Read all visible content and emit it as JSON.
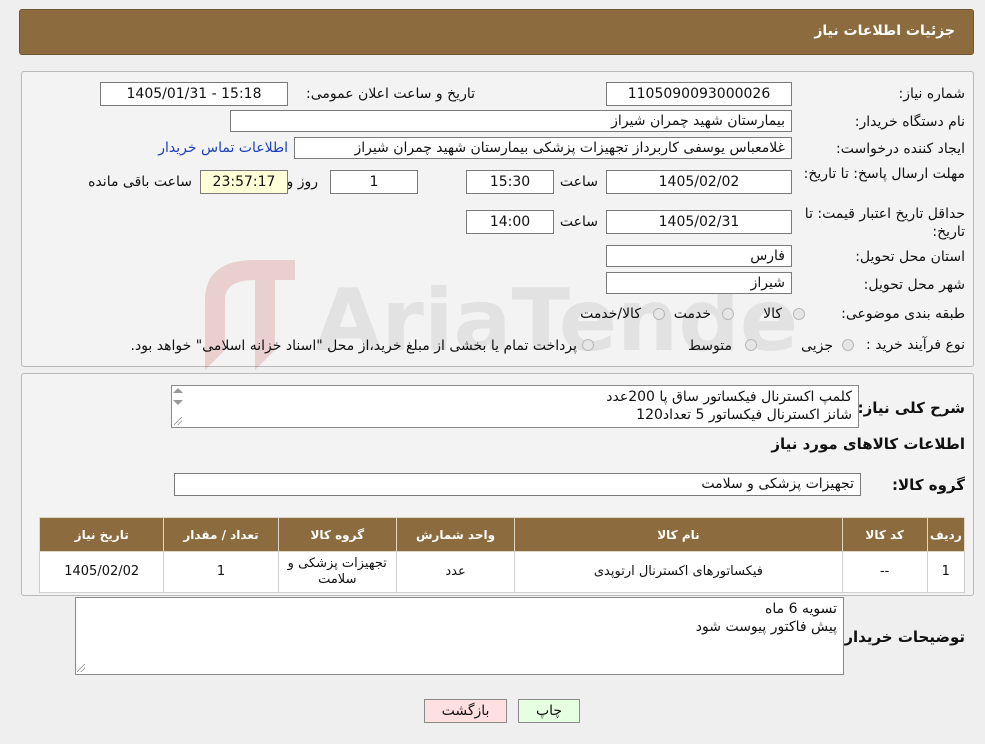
{
  "header": {
    "title": "جزئیات اطلاعات نیاز"
  },
  "info": {
    "need_number_label": "شماره نیاز:",
    "need_number": "1105090093000026",
    "announce_label": "تاریخ و ساعت اعلان عمومی:",
    "announce_value": "1405/01/31 - 15:18",
    "buyer_org_label": "نام دستگاه خریدار:",
    "buyer_org": "بیمارستان شهید چمران شیراز",
    "creator_label": "ایجاد کننده درخواست:",
    "creator": "غلامعباس  یوسفی کاربرداز تجهیزات پزشکی بیمارستان شهید چمران شیراز",
    "contact_link": "اطلاعات تماس خریدار",
    "deadline_label": "مهلت ارسال پاسخ: تا تاریخ:",
    "deadline_date": "1405/02/02",
    "time_label": "ساعت",
    "deadline_time": "15:30",
    "days": "1",
    "days_label": "روز و",
    "remaining": "23:57:17",
    "remaining_label": "ساعت باقی مانده",
    "validity_label": "حداقل تاریخ اعتبار قیمت: تا تاریخ:",
    "validity_date": "1405/02/31",
    "validity_time": "14:00",
    "province_label": "استان محل تحویل:",
    "province": "فارس",
    "city_label": "شهر محل تحویل:",
    "city": "شیراز",
    "category_label": "طبقه بندی موضوعی:",
    "category_options": [
      "کالا",
      "خدمت",
      "کالا/خدمت"
    ],
    "process_label": "نوع فرآیند خرید :",
    "process_options": [
      "جزیی",
      "متوسط"
    ],
    "process_note": "پرداخت تمام یا بخشی از مبلغ خرید،از محل \"اسناد خزانه اسلامی\" خواهد بود."
  },
  "description": {
    "label": "شرح کلی نیاز:",
    "lines": [
      "کلمپ اکسترنال فیکساتور ساق پا 200عدد",
      "شانز اکسترنال فیکساتور 5 تعداد120"
    ]
  },
  "goods": {
    "section_title": "اطلاعات کالاهای مورد نیاز",
    "group_label": "گروه کالا:",
    "group_value": "تجهیزات پزشکی و سلامت",
    "table": {
      "headers": [
        "ردیف",
        "کد کالا",
        "نام کالا",
        "واحد شمارش",
        "گروه کالا",
        "تعداد / مقدار",
        "تاریخ نیاز"
      ],
      "rows": [
        [
          "1",
          "--",
          "فیکساتورهای اکسترنال ارتوپدی",
          "عدد",
          "تجهیزات پزشکی و سلامت",
          "1",
          "1405/02/02"
        ]
      ]
    }
  },
  "buyer_notes": {
    "label": "توضیحات خریدار:",
    "lines": [
      "تسویه 6 ماه",
      "پیش فاکتور پیوست شود"
    ]
  },
  "buttons": {
    "print": "چاپ",
    "back": "بازگشت"
  },
  "watermark": {
    "text": "AriaTender.neT"
  },
  "colors": {
    "header_bg": "#8c6c3f",
    "link": "#1a3fbf",
    "back_button": "#ffe0e0",
    "print_button": "#e6ffe0"
  }
}
